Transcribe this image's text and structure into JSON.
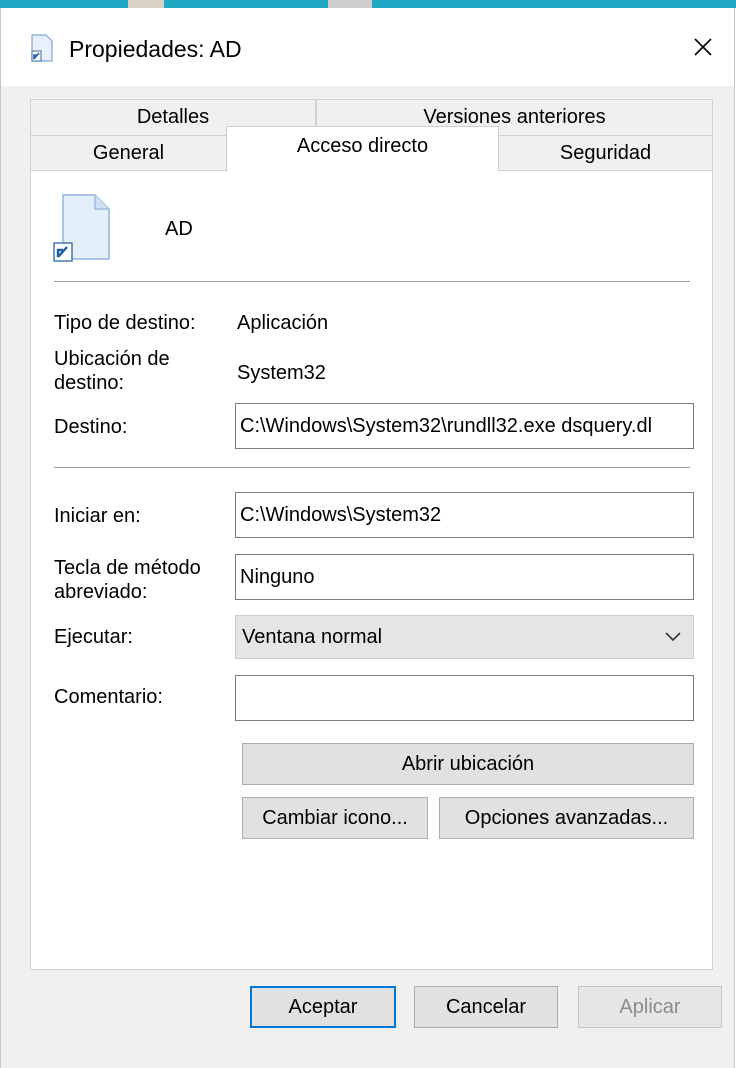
{
  "window": {
    "title": "Propiedades: AD"
  },
  "tabs": {
    "row1": [
      {
        "label": "Detalles"
      },
      {
        "label": "Versiones anteriores"
      }
    ],
    "row2": [
      {
        "label": "General"
      },
      {
        "label": "Acceso directo",
        "active": true
      },
      {
        "label": "Seguridad"
      }
    ]
  },
  "shortcut": {
    "name": "AD",
    "target_type_label": "Tipo de destino:",
    "target_type_value": "Aplicación",
    "target_location_label_line1": "Ubicación de",
    "target_location_label_line2": "destino:",
    "target_location_value": "System32",
    "target_label": "Destino:",
    "target_value": "C:\\Windows\\System32\\rundll32.exe dsquery.dl",
    "start_in_label": "Iniciar en:",
    "start_in_value": "C:\\Windows\\System32",
    "hotkey_label_line1": "Tecla de método",
    "hotkey_label_line2": "abreviado:",
    "hotkey_value": "Ninguno",
    "run_label": "Ejecutar:",
    "run_value": "Ventana normal",
    "comment_label": "Comentario:",
    "comment_value": ""
  },
  "buttons": {
    "open_location": "Abrir ubicación",
    "change_icon": "Cambiar icono...",
    "advanced": "Opciones avanzadas...",
    "ok": "Aceptar",
    "cancel": "Cancelar",
    "apply": "Aplicar"
  },
  "icons": {
    "window_icon": "shortcut-file-icon",
    "close": "close-icon",
    "shortcut_big": "shortcut-file-icon",
    "combo_arrow": "chevron-down-icon"
  },
  "colors": {
    "accent": "#0078d7",
    "dialog_bg": "#f0f0f0",
    "panel_bg": "#ffffff",
    "taskbar_strip": "#1ea8c4"
  }
}
